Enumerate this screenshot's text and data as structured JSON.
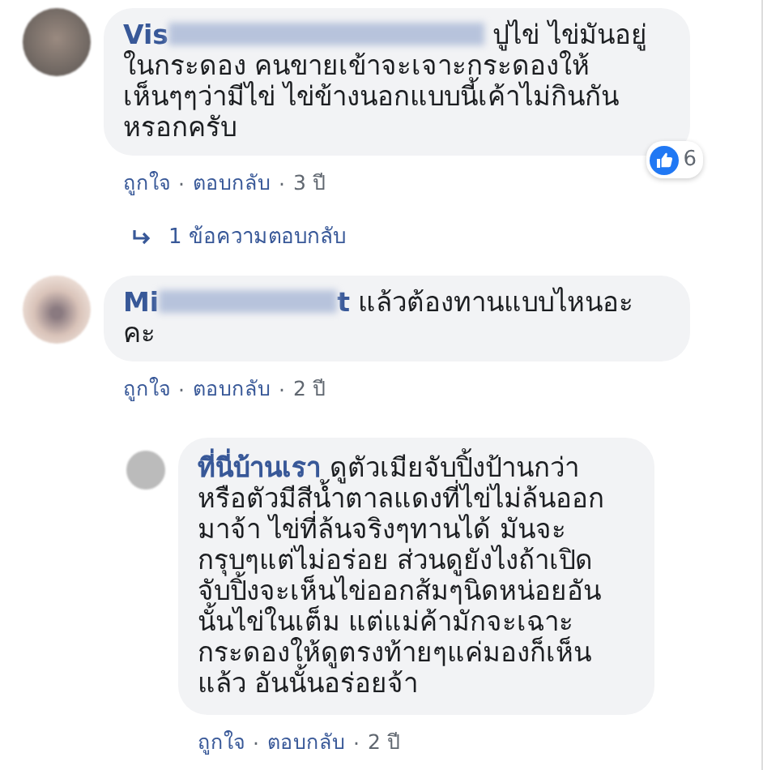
{
  "comments": [
    {
      "author_visible": "Vis",
      "text": "ปูไข่ ไข่มันอยู่ในกระดอง คนขายเข้าจะเจาะกระดองให้เห็นๆๆว่ามีไข่ ไข่ข้างนอกแบบนี้เค้าไม่กินกันหรอกครับ",
      "reactions": "6",
      "actions": [
        "ถูกใจ",
        "ตอบกลับ"
      ],
      "separator": "·",
      "time": "3 ปี",
      "replies_link": "1 ข้อความตอบกลับ",
      "is_reply": false
    },
    {
      "author_visible": "Mi",
      "author_tail": "t",
      "text": "แล้วต้องทานแบบไหนอะคะ",
      "actions": [
        "ถูกใจ",
        "ตอบกลับ"
      ],
      "separator": "·",
      "time": "2 ปี",
      "is_reply": false
    },
    {
      "author_visible": "ที่นี่บ้านเรา",
      "text": "ดูตัวเมียจับปิ้งป้านกว่าหรือตัวมีสีน้ำตาลแดงที่ไข่ไม่ล้นออกมาจ้า ไข่ที่ล้นจริงๆทานได้ มันจะกรุบๆแต่ไม่อร่อย ส่วนดูยังไงถ้าเปิดจับปิ้งจะเห็นไข่ออกส้มๆนิดหน่อยอันนั้นไข่ในเต็ม แต่แม่ค้ามักจะเฉาะกระดองให้ดูตรงท้ายๆแค่มองก็เห็นแล้ว อันนั้นอร่อยจ้า",
      "actions": [
        "ถูกใจ",
        "ตอบกลับ"
      ],
      "separator": "·",
      "time": "2 ปี",
      "is_reply": true
    }
  ]
}
